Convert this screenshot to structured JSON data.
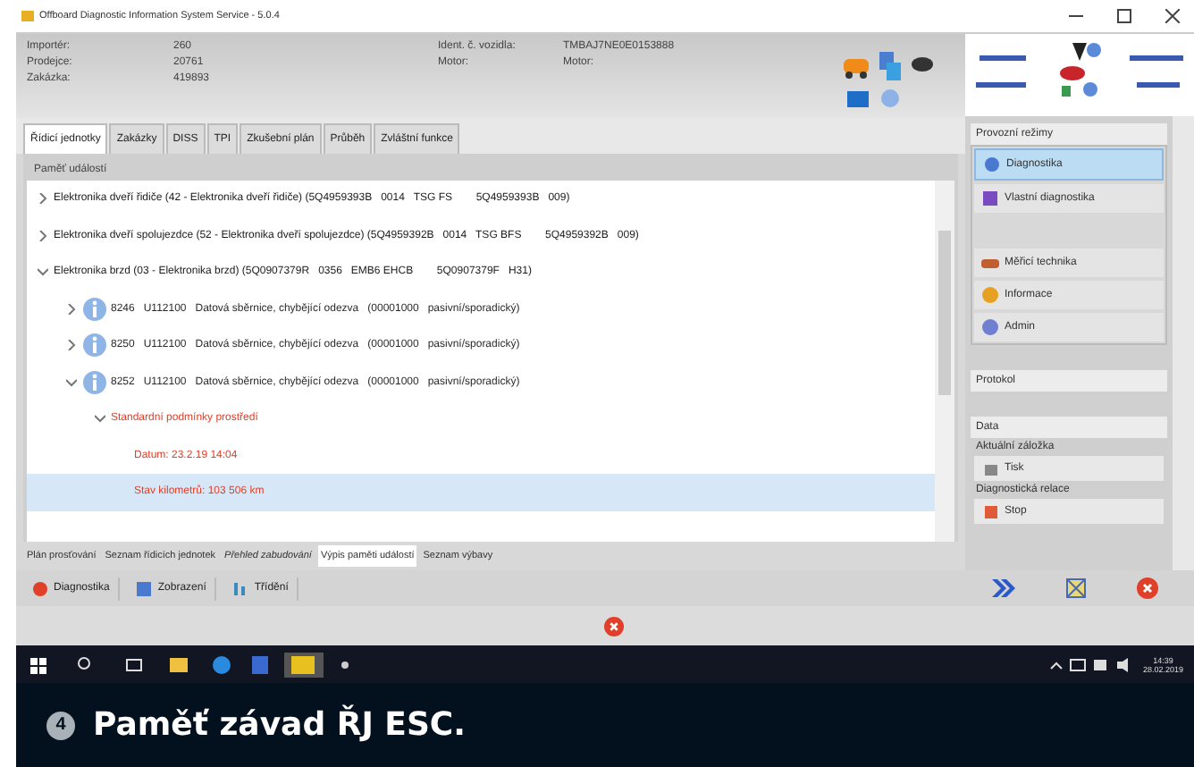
{
  "window": {
    "title": "Offboard Diagnostic Information System Service - 5.0.4"
  },
  "info": {
    "left": [
      {
        "label": "Importér:",
        "value": "260"
      },
      {
        "label": "Prodejce:",
        "value": "20761"
      },
      {
        "label": "Zakázka:",
        "value": "419893"
      }
    ],
    "middle": [
      {
        "label": "Ident. č. vozidla:",
        "value": "TMBAJ7NE0E0153888"
      },
      {
        "label": "Motor:",
        "value": "Motor:"
      }
    ]
  },
  "tabs": [
    {
      "label": "Řídicí jednotky",
      "selected": true
    },
    {
      "label": "Zakázky",
      "selected": false
    },
    {
      "label": "DISS",
      "selected": false
    },
    {
      "label": "TPI",
      "selected": false
    },
    {
      "label": "Zkušební plán",
      "selected": false
    },
    {
      "label": "Průběh",
      "selected": false
    },
    {
      "label": "Zvláštní funkce",
      "selected": false
    }
  ],
  "panel": {
    "title": "Paměť událostí",
    "tree": [
      {
        "kind": "unit",
        "text": "Elektronika dveří řidiče (42 - Elektronika dveří řidiče) (5Q4959393B   0014   TSG FS        5Q4959393B   009)",
        "expanded": false,
        "selected": false
      },
      {
        "kind": "unit",
        "text": "Elektronika dveří spolujezdce (52 - Elektronika dveří spolujezdce) (5Q4959392B   0014   TSG BFS        5Q4959392B   009)",
        "expanded": false,
        "selected": false
      },
      {
        "kind": "unit",
        "text": "Elektronika brzd (03 - Elektronika brzd) (5Q0907379R   0356   EMB6 EHCB        5Q0907379F   H31)",
        "expanded": true,
        "selected": false,
        "children": [
          {
            "kind": "event",
            "text": "8246   U112100   Datová sběrnice, chybějící odezva   (00001000   pasivní/sporadický)",
            "expanded": false,
            "selected": false
          },
          {
            "kind": "event",
            "text": "8250   U112100   Datová sběrnice, chybějící odezva   (00001000   pasivní/sporadický)",
            "expanded": false,
            "selected": false
          },
          {
            "kind": "event",
            "text": "8252   U112100   Datová sběrnice, chybějící odezva   (00001000   pasivní/sporadický)",
            "expanded": true,
            "selected": false,
            "children": [
              {
                "kind": "group",
                "text": "Standardní podmínky prostředí",
                "expanded": true,
                "selected": false,
                "children": [
                  {
                    "kind": "value",
                    "text": "Datum: 23.2.19 14:04",
                    "selected": false
                  },
                  {
                    "kind": "value",
                    "text": "Stav kilometrů: 103 506 km",
                    "selected": true
                  }
                ]
              }
            ]
          }
        ]
      }
    ]
  },
  "bottom_tabs": [
    {
      "label": "Plán prosťování",
      "selected": false,
      "italic": false
    },
    {
      "label": "Seznam řídicích jednotek",
      "selected": false,
      "italic": false
    },
    {
      "label": "Přehled zabudování",
      "selected": false,
      "italic": true
    },
    {
      "label": "Výpis paměti událostí",
      "selected": true,
      "italic": false
    },
    {
      "label": "Seznam výbavy",
      "selected": false,
      "italic": false
    }
  ],
  "sidebar": {
    "title": "Provozní režimy",
    "items": [
      {
        "label": "Diagnostika",
        "kind": "diag",
        "selected": true
      },
      {
        "label": "Vlastní diagnostika",
        "kind": "own",
        "selected": false
      },
      {
        "label": "Měřicí technika",
        "kind": "meter",
        "selected": false
      },
      {
        "label": "Informace",
        "kind": "info",
        "selected": false
      },
      {
        "label": "Admin",
        "kind": "admin",
        "selected": false
      }
    ],
    "protocol": "Protokol",
    "data": "Data",
    "current_tab": "Aktuální záložka",
    "print": "Tisk",
    "session": "Diagnostická relace",
    "stop": "Stop"
  },
  "toolbar": [
    {
      "label": "Diagnostika",
      "kind": "diag"
    },
    {
      "label": "Zobrazení",
      "kind": "view"
    },
    {
      "label": "Třídění",
      "kind": "sort"
    }
  ],
  "taskbar": {
    "time": "14:39",
    "date": "28.02.2019"
  },
  "caption": {
    "number": "4",
    "text": "Paměť závad ŘJ ESC."
  }
}
